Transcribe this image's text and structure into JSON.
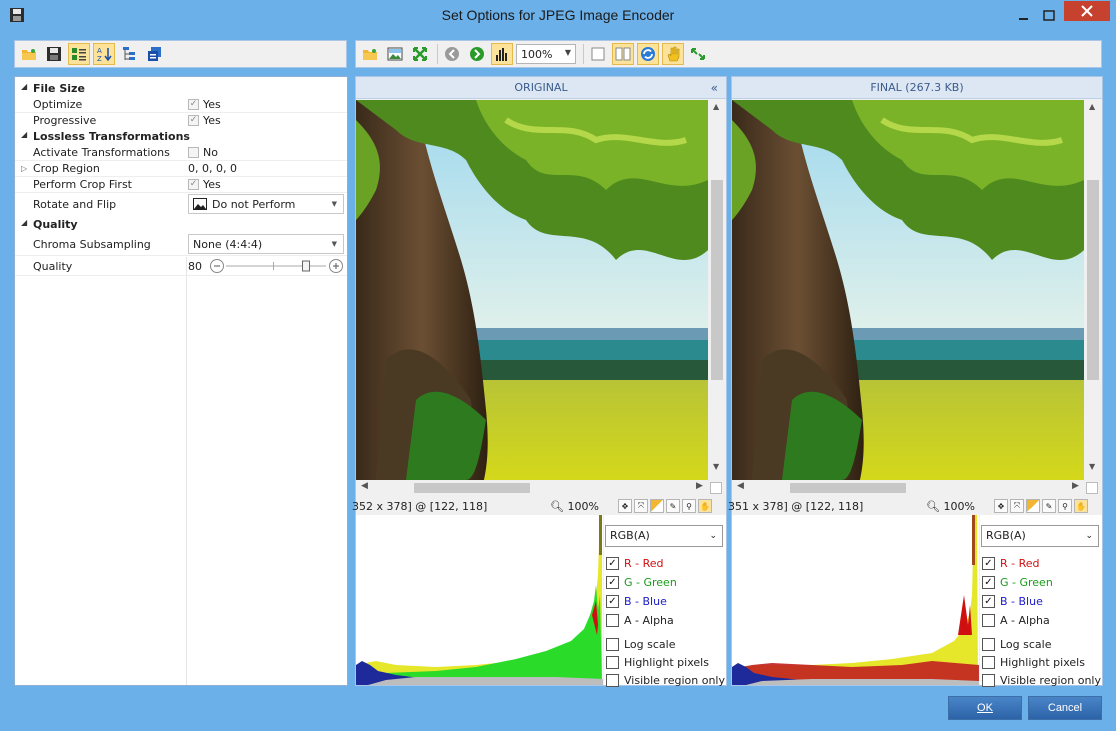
{
  "window": {
    "title": "Set Options for JPEG Image Encoder",
    "zoom_select": "100%"
  },
  "properties": {
    "categories": [
      {
        "label": "File Size"
      },
      {
        "label": "Lossless Transformations"
      },
      {
        "label": "Quality"
      }
    ],
    "optimize": {
      "label": "Optimize",
      "value": "Yes"
    },
    "progressive": {
      "label": "Progressive",
      "value": "Yes"
    },
    "activate_transformations": {
      "label": "Activate Transformations",
      "value": "No"
    },
    "crop_region": {
      "label": "Crop Region",
      "value": "0, 0, 0, 0"
    },
    "perform_crop_first": {
      "label": "Perform Crop First",
      "value": "Yes"
    },
    "rotate_and_flip": {
      "label": "Rotate and Flip",
      "value": "Do not Perform"
    },
    "chroma_subsampling": {
      "label": "Chroma Subsampling",
      "value": "None (4:4:4)"
    },
    "quality": {
      "label": "Quality",
      "value": "80",
      "level": 80
    }
  },
  "original": {
    "header": "ORIGINAL",
    "collapse": "«",
    "coords": "352 x 378] @ [122, 118]",
    "zoom": "100%"
  },
  "final": {
    "header": "FINAL (267.3 KB)",
    "coords": "351 x 378] @ [122, 118]",
    "zoom": "100%"
  },
  "histogram": {
    "channel": "RGB(A)",
    "red": "R - Red",
    "green": "G - Green",
    "blue": "B - Blue",
    "alpha": "A - Alpha",
    "log_scale": "Log scale",
    "highlight": "Highlight pixels",
    "visible_only": "Visible region only",
    "colors": {
      "red": "#d01010",
      "green": "#1a9a1a",
      "blue": "#1a1ac8"
    }
  },
  "buttons": {
    "ok": "OK",
    "cancel": "Cancel"
  }
}
